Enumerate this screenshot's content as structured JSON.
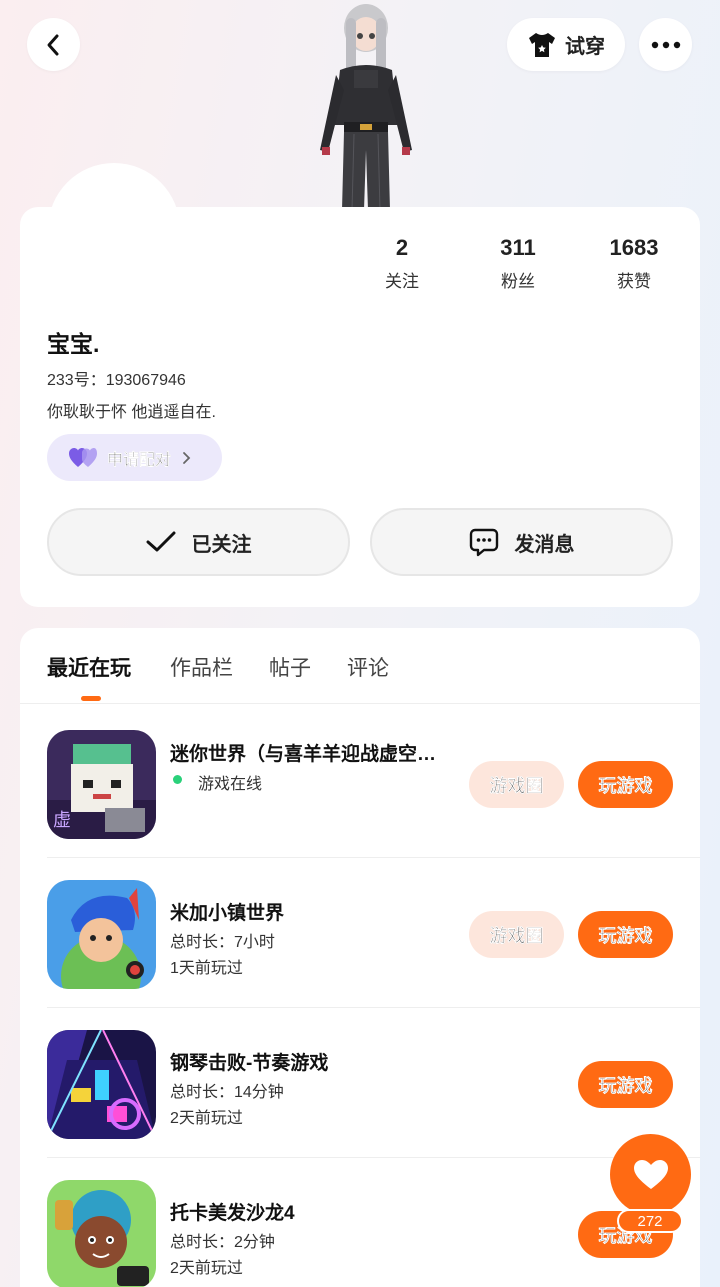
{
  "header": {
    "try_on_label": "试穿"
  },
  "profile": {
    "stats": [
      {
        "value": "2",
        "label": "关注"
      },
      {
        "value": "311",
        "label": "粉丝"
      },
      {
        "value": "1683",
        "label": "获赞"
      }
    ],
    "username": "宝宝.",
    "uid": "233号：193067946",
    "bio": "你耿耿于怀 他逍遥自在.",
    "pair_label": "申请配对",
    "follow_label": "已关注",
    "message_label": "发消息"
  },
  "tabs": [
    "最近在玩",
    "作品栏",
    "帖子",
    "评论"
  ],
  "games": [
    {
      "name": "迷你世界（与喜羊羊迎战虚空…",
      "line1": "游戏在线",
      "line2": "",
      "circle": "游戏圈",
      "play": "玩游戏"
    },
    {
      "name": "米加小镇世界",
      "line1": "总时长：7小时",
      "line2": "1天前玩过",
      "circle": "游戏圈",
      "play": "玩游戏"
    },
    {
      "name": "钢琴击败-节奏游戏",
      "line1": "总时长：14分钟",
      "line2": "2天前玩过",
      "circle": "",
      "play": "玩游戏"
    },
    {
      "name": "托卡美发沙龙4",
      "line1": "总时长：2分钟",
      "line2": "2天前玩过",
      "circle": "",
      "play": "玩游戏"
    }
  ],
  "like_count": "272",
  "colors": {
    "accent": "#ff6a13",
    "pair_bg": "#ece9fb",
    "circle_bg": "#fde6dc",
    "online": "#2ad17a"
  }
}
